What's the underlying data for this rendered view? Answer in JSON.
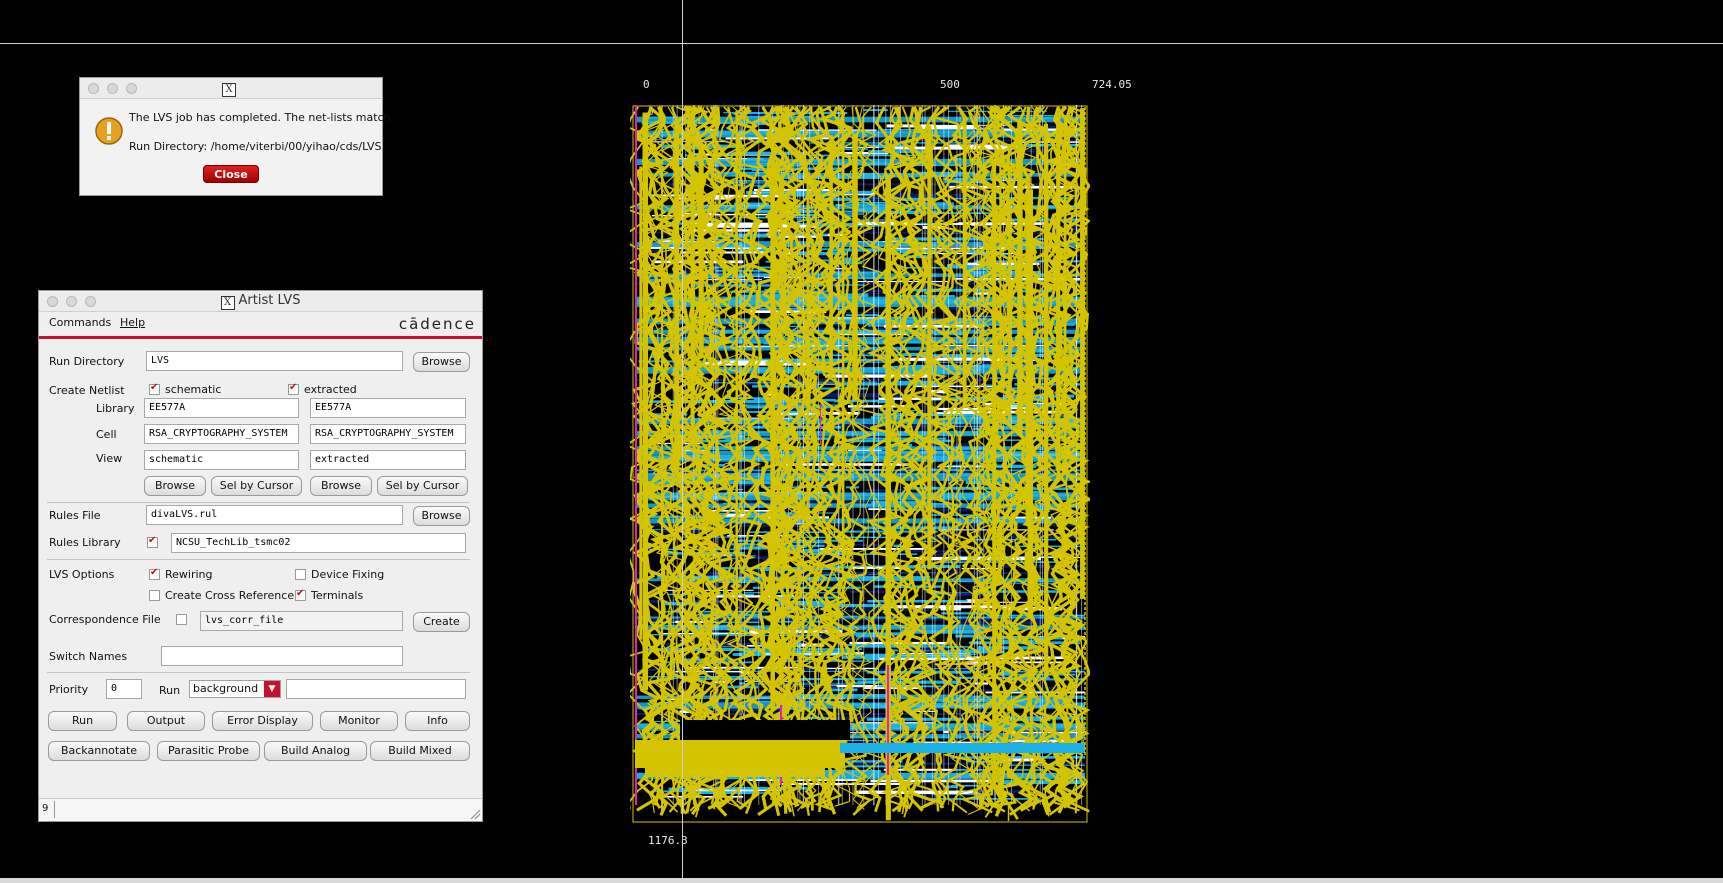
{
  "canvas": {
    "ruler_top": [
      "0",
      "500",
      "724.05"
    ],
    "ruler_bottom": "1176.3",
    "corner_mark": "0"
  },
  "message_dialog": {
    "line1": "The LVS job has completed. The net-lists match.",
    "line2": "Run Directory: /home/viterbi/00/yihao/cds/LVS",
    "close_label": "Close"
  },
  "lvs": {
    "title": "Artist LVS",
    "menu": {
      "commands": "Commands",
      "help": "Help",
      "logo": "cādence"
    },
    "run_directory": {
      "label": "Run Directory",
      "value": "LVS",
      "browse": "Browse"
    },
    "create_netlist": {
      "label": "Create Netlist",
      "schematic": {
        "label": "schematic",
        "checked": true
      },
      "extracted": {
        "label": "extracted",
        "checked": true
      },
      "library_label": "Library",
      "cell_label": "Cell",
      "view_label": "View",
      "schematic_library": "EE577A",
      "extracted_library": "EE577A",
      "schematic_cell": "RSA_CRYPTOGRAPHY_SYSTEM",
      "extracted_cell": "RSA_CRYPTOGRAPHY_SYSTEM",
      "schematic_view": "schematic",
      "extracted_view": "extracted",
      "browse": "Browse",
      "sel_by_cursor": "Sel by Cursor"
    },
    "rules_file": {
      "label": "Rules File",
      "value": "divaLVS.rul",
      "browse": "Browse"
    },
    "rules_library": {
      "label": "Rules Library",
      "value": "NCSU_TechLib_tsmc02",
      "checked": true
    },
    "lvs_options": {
      "label": "LVS Options",
      "rewiring": "Rewiring",
      "device_fixing": "Device Fixing",
      "cross_reference": "Create Cross Reference",
      "terminals": "Terminals"
    },
    "correspondence": {
      "label": "Correspondence File",
      "value": "lvs_corr_file",
      "create": "Create"
    },
    "switch_names": {
      "label": "Switch Names",
      "value": ""
    },
    "priority": {
      "label": "Priority",
      "value": "0"
    },
    "run": {
      "label": "Run",
      "mode": "background",
      "extra": ""
    },
    "buttons_row1": [
      "Run",
      "Output",
      "Error Display",
      "Monitor",
      "Info"
    ],
    "buttons_row2": [
      "Backannotate",
      "Parasitic Probe",
      "Build Analog",
      "Build Mixed"
    ],
    "status_number": "9"
  },
  "colors": {
    "accent": "#c8102e",
    "layout_cyan": "#1ab0e8",
    "layout_yellow": "#d4c400",
    "layout_magenta": "#e020c0",
    "layout_navy": "#0a1a6a"
  }
}
